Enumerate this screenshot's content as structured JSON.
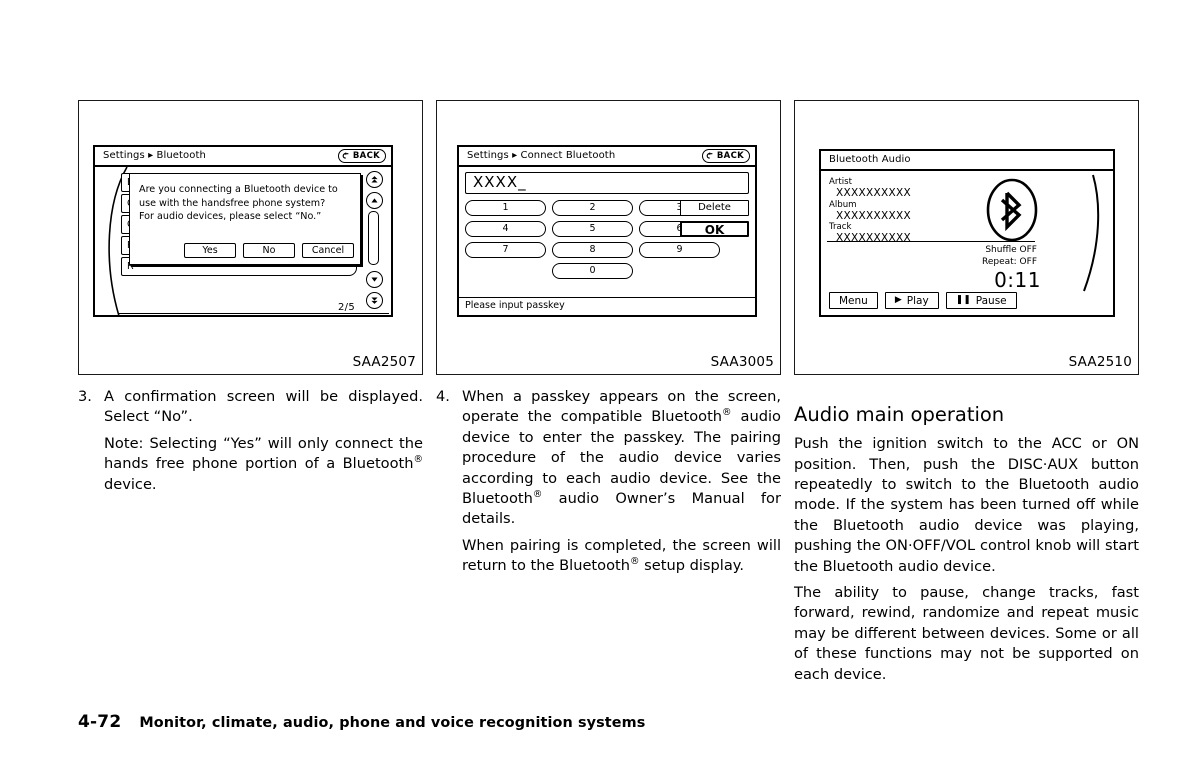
{
  "figures": [
    {
      "caption": "SAA2507",
      "screen": {
        "title": "Settings ▸ Bluetooth",
        "back_label": "BACK",
        "list_rows": [
          "B",
          "C",
          "C",
          "R",
          "R"
        ],
        "page_indicator": "2/5",
        "scroll_buttons": [
          "double-up-arrow-icon",
          "up-arrow-icon",
          "down-arrow-icon",
          "double-down-arrow-icon"
        ],
        "dialog": {
          "line1": "Are you connecting a Bluetooth device to",
          "line2": "use with the handsfree phone system?",
          "line3": "For audio devices, please select “No.”",
          "buttons": [
            "Yes",
            "No",
            "Cancel"
          ]
        }
      }
    },
    {
      "caption": "SAA3005",
      "screen": {
        "title": "Settings ▸ Connect Bluetooth",
        "back_label": "BACK",
        "passkey_value": "XXXX_",
        "keys": [
          [
            "1",
            "2",
            "3"
          ],
          [
            "4",
            "5",
            "6"
          ],
          [
            "7",
            "8",
            "9"
          ],
          [
            "0"
          ]
        ],
        "function_keys": [
          "Delete",
          "OK"
        ],
        "status_text": "Please input passkey"
      }
    },
    {
      "caption": "SAA2510",
      "screen": {
        "title": "Bluetooth Audio",
        "meta": [
          {
            "label": "Artist",
            "value": "XXXXXXXXXX"
          },
          {
            "label": "Album",
            "value": "XXXXXXXXXX"
          },
          {
            "label": "Track",
            "value": "XXXXXXXXXX"
          }
        ],
        "shuffle": "Shuffle OFF",
        "repeat": "Repeat: OFF",
        "time": "0:11",
        "logo": "bluetooth-logo-icon",
        "transport": [
          {
            "label": "Menu",
            "glyph": ""
          },
          {
            "label": "Play",
            "glyph": "▶"
          },
          {
            "label": "Pause",
            "glyph": "❚❚"
          }
        ]
      }
    }
  ],
  "column1": {
    "step_number": "3.",
    "step_text": "A confirmation screen will be displayed. Select “No”.",
    "note_text_a": "Note: Selecting “Yes” will only connect the hands free phone portion of a Bluetooth",
    "note_text_b": " device."
  },
  "column2": {
    "step_number": "4.",
    "step_text_a": "When a passkey appears on the screen, operate the compatible Bluetooth",
    "step_text_b": " audio device to enter the passkey. The pairing procedure of the audio device varies according to each audio device. See the Bluetooth",
    "step_text_c": " audio Owner’s Manual for details.",
    "para2_a": "When pairing is completed, the screen will return to the Bluetooth",
    "para2_b": " setup display."
  },
  "column3": {
    "heading": "Audio main operation",
    "para1": "Push the ignition switch to the ACC or ON position. Then, push the DISC·AUX button repeatedly to switch to the Bluetooth audio mode. If the system has been turned off while the Bluetooth audio device was playing, pushing the ON·OFF/VOL control knob will start the Bluetooth audio device.",
    "para2": "The ability to pause, change tracks, fast forward, rewind, randomize and repeat music may be different between devices. Some or all of these functions may not be supported on each device."
  },
  "footer": {
    "page_number": "4-72",
    "title": "Monitor, climate, audio, phone and voice recognition systems"
  }
}
